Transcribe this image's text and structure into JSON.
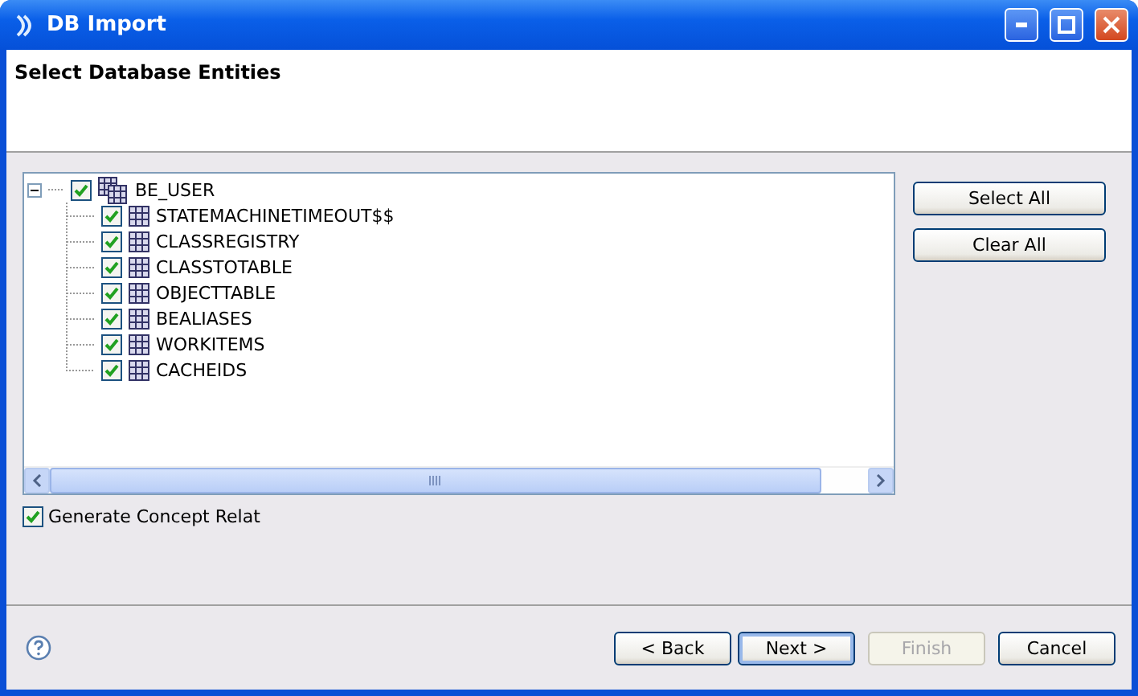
{
  "window": {
    "title": "DB Import"
  },
  "header": {
    "title": "Select Database Entities"
  },
  "tree": {
    "label": "BE_USER",
    "checked": true,
    "expanded": true,
    "children": [
      {
        "label": "STATEMACHINETIMEOUT$$",
        "checked": true
      },
      {
        "label": "CLASSREGISTRY",
        "checked": true
      },
      {
        "label": "CLASSTOTABLE",
        "checked": true
      },
      {
        "label": "OBJECTTABLE",
        "checked": true
      },
      {
        "label": "BEALIASES",
        "checked": true
      },
      {
        "label": "WORKITEMS",
        "checked": true
      },
      {
        "label": "CACHEIDS",
        "checked": true
      }
    ]
  },
  "side_buttons": [
    "Select All",
    "Clear All"
  ],
  "option": {
    "label": "Generate Concept Relat",
    "checked": true
  },
  "footer_buttons": [
    {
      "label": "< Back",
      "disabled": false,
      "selected": false
    },
    {
      "label": "Next >",
      "disabled": false,
      "selected": true
    },
    {
      "label": "Finish",
      "disabled": true,
      "selected": false
    },
    {
      "label": "Cancel",
      "disabled": false,
      "selected": false
    }
  ]
}
